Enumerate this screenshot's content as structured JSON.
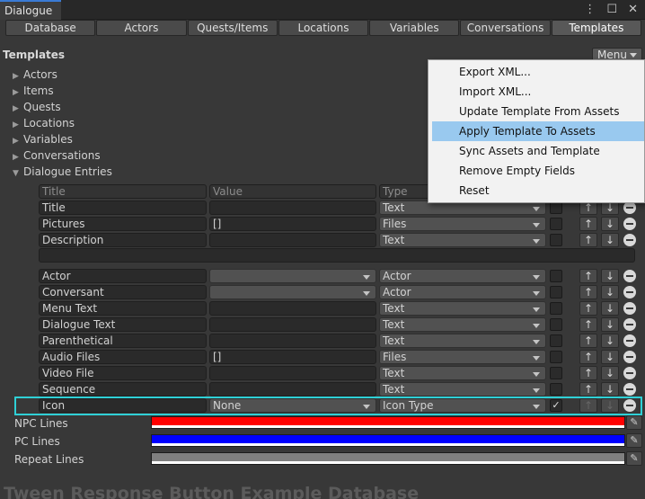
{
  "window": {
    "tab_title": "Dialogue",
    "controls": "⋮ ☐ ✕"
  },
  "tabs": [
    "Database",
    "Actors",
    "Quests/Items",
    "Locations",
    "Variables",
    "Conversations",
    "Templates"
  ],
  "active_tab": "Templates",
  "section": {
    "title": "Templates",
    "menu_label": "Menu"
  },
  "tree": {
    "items": [
      "Actors",
      "Items",
      "Quests",
      "Locations",
      "Variables",
      "Conversations"
    ],
    "expanded_label": "Dialogue Entries"
  },
  "table": {
    "headers": [
      "Title",
      "Value",
      "Type"
    ],
    "rows_top": [
      {
        "title": "Title",
        "value": "",
        "type": "Text"
      },
      {
        "title": "Pictures",
        "value": "[]",
        "type": "Files"
      },
      {
        "title": "Description",
        "value": "",
        "type": "Text"
      }
    ],
    "rows_main": [
      {
        "title": "Actor",
        "value": "",
        "type": "Actor",
        "value_dropdown": true,
        "checked": false
      },
      {
        "title": "Conversant",
        "value": "",
        "type": "Actor",
        "value_dropdown": true,
        "checked": false
      },
      {
        "title": "Menu Text",
        "value": "",
        "type": "Text",
        "value_dropdown": false,
        "checked": false
      },
      {
        "title": "Dialogue Text",
        "value": "",
        "type": "Text",
        "value_dropdown": false,
        "checked": false
      },
      {
        "title": "Parenthetical",
        "value": "",
        "type": "Text",
        "value_dropdown": false,
        "checked": false
      },
      {
        "title": "Audio Files",
        "value": "[]",
        "type": "Files",
        "value_dropdown": false,
        "checked": false
      },
      {
        "title": "Video File",
        "value": "",
        "type": "Text",
        "value_dropdown": false,
        "checked": false
      },
      {
        "title": "Sequence",
        "value": "",
        "type": "Text",
        "value_dropdown": false,
        "checked": false
      },
      {
        "title": "Icon",
        "value": "None",
        "type": "Icon Type",
        "value_dropdown": true,
        "checked": true
      }
    ]
  },
  "colors": {
    "npc_label": "NPC Lines",
    "npc_color": "#ff0000",
    "pc_label": "PC Lines",
    "pc_color": "#0000ff",
    "repeat_label": "Repeat Lines",
    "repeat_color": "#808080"
  },
  "popup_menu": {
    "items": [
      "Export XML...",
      "Import XML...",
      "Update Template From Assets",
      "Apply Template To Assets",
      "Sync Assets and Template",
      "Remove Empty Fields",
      "Reset"
    ],
    "selected_index": 3
  },
  "footer": {
    "database_name": "Tween Response Button Example Database"
  },
  "theme": {
    "highlight_color": "#2fd0d6",
    "popup_selected_color": "#99c9ef"
  }
}
